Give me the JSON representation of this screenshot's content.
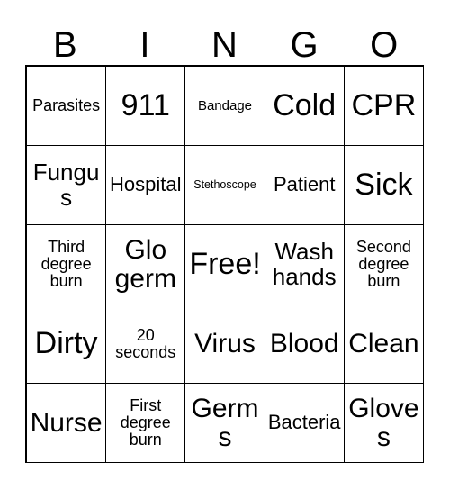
{
  "card": {
    "title_letters": [
      "B",
      "I",
      "N",
      "G",
      "O"
    ],
    "background_color": "#ffffff",
    "border_color": "#000000",
    "text_color": "#000000",
    "columns": 5,
    "rows": 5,
    "rows_data": [
      [
        {
          "text": "Parasites",
          "size": "s"
        },
        {
          "text": "911",
          "size": "xxl"
        },
        {
          "text": "Bandage",
          "size": "xs"
        },
        {
          "text": "Cold",
          "size": "xxl"
        },
        {
          "text": "CPR",
          "size": "xxl"
        }
      ],
      [
        {
          "text": "Fungus",
          "size": "l"
        },
        {
          "text": "Hospital",
          "size": "m"
        },
        {
          "text": "Stethoscope",
          "size": "xxs"
        },
        {
          "text": "Patient",
          "size": "m"
        },
        {
          "text": "Sick",
          "size": "xxl"
        }
      ],
      [
        {
          "text": "Third degree burn",
          "size": "s"
        },
        {
          "text": "Glo germ",
          "size": "xl"
        },
        {
          "text": "Free!",
          "size": "xxl"
        },
        {
          "text": "Wash hands",
          "size": "l"
        },
        {
          "text": "Second degree burn",
          "size": "s"
        }
      ],
      [
        {
          "text": "Dirty",
          "size": "xxl"
        },
        {
          "text": "20 seconds",
          "size": "s"
        },
        {
          "text": "Virus",
          "size": "xl"
        },
        {
          "text": "Blood",
          "size": "xl"
        },
        {
          "text": "Clean",
          "size": "xl"
        }
      ],
      [
        {
          "text": "Nurse",
          "size": "xl"
        },
        {
          "text": "First degree burn",
          "size": "s"
        },
        {
          "text": "Germs",
          "size": "xl"
        },
        {
          "text": "Bacteria",
          "size": "m"
        },
        {
          "text": "Gloves",
          "size": "xl"
        }
      ]
    ]
  }
}
